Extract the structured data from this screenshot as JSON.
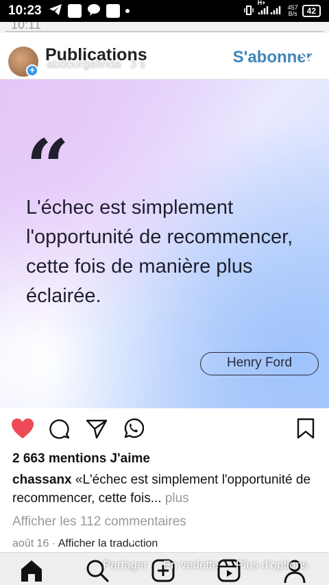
{
  "status_bar": {
    "time": "10:23",
    "network": "H+",
    "net_speed_value": "457",
    "net_speed_unit": "B/s",
    "battery": "42"
  },
  "header": {
    "title": "Publications",
    "username": "abdourgafinda",
    "time_ago": "3 s",
    "follow_label": "S'abonner",
    "close_icon": "close-icon"
  },
  "post": {
    "quote": "L'échec est simplement l'opportunité de recommencer, cette fois de manière plus éclairée.",
    "author": "Henry Ford",
    "colors": {
      "gradient_start": "#d9c6f7",
      "gradient_end": "#b8d3fb",
      "text": "#1f1f2e"
    }
  },
  "actions": {
    "like_icon": "heart-filled-icon",
    "comment_icon": "comment-icon",
    "share_icon": "send-icon",
    "whatsapp_icon": "whatsapp-icon",
    "save_icon": "bookmark-icon",
    "like_color": "#ed4956"
  },
  "likes_text": "2 663 mentions J'aime",
  "caption": {
    "user": "chassanx",
    "text": "«L'échec est simplement l'opportunité de recommencer, cette fois...",
    "more": " plus"
  },
  "comments_link": "Afficher les 112 commentaires",
  "date": {
    "value": "août 16",
    "separator": " · ",
    "translate": "Afficher la traduction"
  },
  "overlay": {
    "share": "Partager",
    "featured": "En vedette",
    "more_options": "Plus d'options"
  },
  "bottom_nav": [
    "home-icon",
    "search-icon",
    "add-post-icon",
    "reels-icon",
    "profile-icon"
  ]
}
